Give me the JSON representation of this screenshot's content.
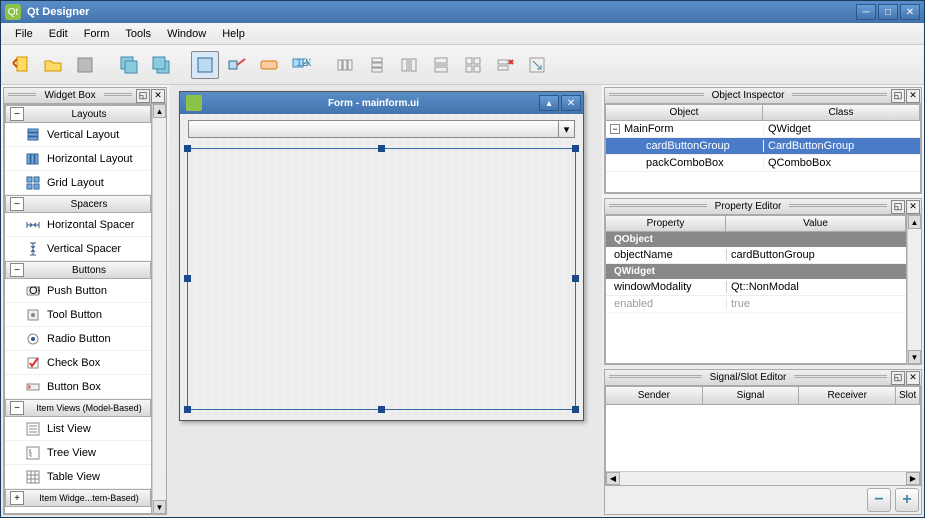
{
  "window": {
    "title": "Qt Designer"
  },
  "menu": {
    "file": "File",
    "edit": "Edit",
    "form": "Form",
    "tools": "Tools",
    "window": "Window",
    "help": "Help"
  },
  "widgetbox": {
    "title": "Widget Box",
    "cats": {
      "layouts": "Layouts",
      "spacers": "Spacers",
      "buttons": "Buttons",
      "itemviews": "Item Views (Model-Based)",
      "itemwidgets": "Item Widge...tem-Based)"
    },
    "items": {
      "vlayout": "Vertical Layout",
      "hlayout": "Horizontal Layout",
      "gridlayout": "Grid Layout",
      "hspacer": "Horizontal Spacer",
      "vspacer": "Vertical Spacer",
      "pushbutton": "Push Button",
      "toolbutton": "Tool Button",
      "radiobutton": "Radio Button",
      "checkbox": "Check Box",
      "buttonbox": "Button Box",
      "listview": "List View",
      "treeview": "Tree View",
      "tableview": "Table View"
    }
  },
  "form": {
    "title": "Form - mainform.ui"
  },
  "objectinspector": {
    "title": "Object Inspector",
    "headers": {
      "object": "Object",
      "class": "Class"
    },
    "rows": [
      {
        "object": "MainForm",
        "class": "QWidget",
        "indent": 0,
        "expander": true,
        "selected": false
      },
      {
        "object": "cardButtonGroup",
        "class": "CardButtonGroup",
        "indent": 1,
        "expander": false,
        "selected": true
      },
      {
        "object": "packComboBox",
        "class": "QComboBox",
        "indent": 1,
        "expander": false,
        "selected": false
      }
    ]
  },
  "propertyeditor": {
    "title": "Property Editor",
    "headers": {
      "property": "Property",
      "value": "Value"
    },
    "groups": {
      "qobject": "QObject",
      "qwidget": "QWidget"
    },
    "props": {
      "objectName": {
        "name": "objectName",
        "value": "cardButtonGroup"
      },
      "windowModality": {
        "name": "windowModality",
        "value": "Qt::NonModal"
      },
      "enabled": {
        "name": "enabled",
        "value": "true"
      }
    }
  },
  "signalslot": {
    "title": "Signal/Slot Editor",
    "headers": {
      "sender": "Sender",
      "signal": "Signal",
      "receiver": "Receiver",
      "slot": "Slot"
    }
  }
}
